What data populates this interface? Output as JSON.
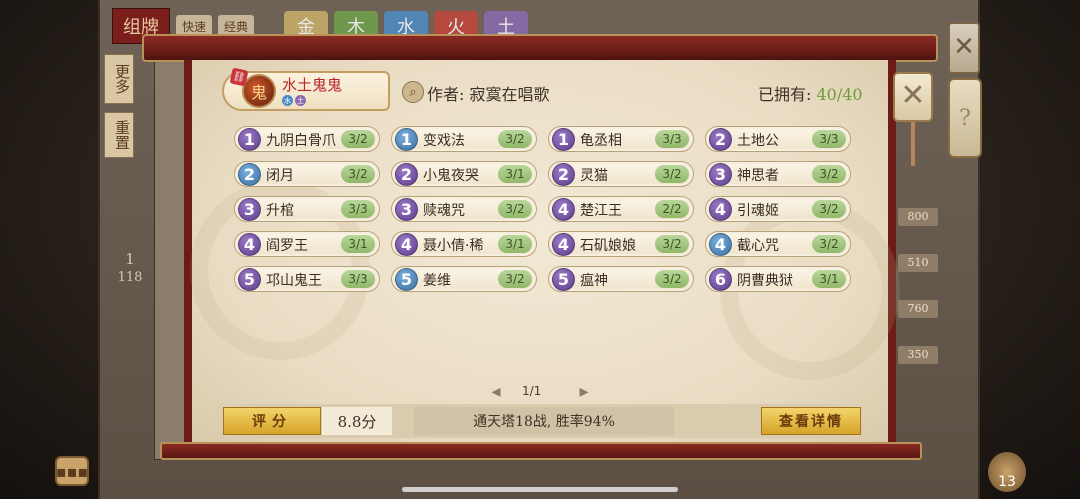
{
  "background": {
    "title": "组牌",
    "pills": [
      "快速",
      "经典"
    ],
    "elements": [
      {
        "label": "金",
        "color": "#c9b06a"
      },
      {
        "label": "木",
        "color": "#6fa24a"
      },
      {
        "label": "水",
        "color": "#4c8cc4"
      },
      {
        "label": "火",
        "color": "#c2453a"
      },
      {
        "label": "土",
        "color": "#8a6bb0"
      }
    ],
    "side_buttons": [
      "更多",
      "重置"
    ],
    "left_count": "1",
    "left_count_total": "118",
    "right_numbers": [
      "800",
      "510",
      "760",
      "350"
    ],
    "bag_count": "13"
  },
  "deck": {
    "name": "水土鬼鬼",
    "author_label": "作者:",
    "author": "寂寞在唱歌",
    "owned_label": "已拥有:",
    "owned_value": "40/40"
  },
  "cards": [
    {
      "cost": "1",
      "color": "purple",
      "name": "九阴白骨爪",
      "qty": "3/2"
    },
    {
      "cost": "1",
      "color": "blue",
      "name": "变戏法",
      "qty": "3/2"
    },
    {
      "cost": "1",
      "color": "purple",
      "name": "龟丞相",
      "qty": "3/3"
    },
    {
      "cost": "2",
      "color": "purple",
      "name": "土地公",
      "qty": "3/3"
    },
    {
      "cost": "2",
      "color": "blue",
      "name": "闭月",
      "qty": "3/2"
    },
    {
      "cost": "2",
      "color": "purple",
      "name": "小鬼夜哭",
      "qty": "3/1"
    },
    {
      "cost": "2",
      "color": "purple",
      "name": "灵猫",
      "qty": "3/2"
    },
    {
      "cost": "3",
      "color": "purple",
      "name": "神思者",
      "qty": "3/2"
    },
    {
      "cost": "3",
      "color": "purple",
      "name": "升棺",
      "qty": "3/3"
    },
    {
      "cost": "3",
      "color": "purple",
      "name": "赎魂咒",
      "qty": "3/2"
    },
    {
      "cost": "4",
      "color": "purple",
      "name": "楚江王",
      "qty": "2/2"
    },
    {
      "cost": "4",
      "color": "purple",
      "name": "引魂姬",
      "qty": "3/2"
    },
    {
      "cost": "4",
      "color": "purple",
      "name": "阎罗王",
      "qty": "3/1"
    },
    {
      "cost": "4",
      "color": "purple",
      "name": "聂小倩·稀",
      "qty": "3/1"
    },
    {
      "cost": "4",
      "color": "purple",
      "name": "石矶娘娘",
      "qty": "3/2"
    },
    {
      "cost": "4",
      "color": "blue",
      "name": "截心咒",
      "qty": "3/2"
    },
    {
      "cost": "5",
      "color": "purple",
      "name": "邛山鬼王",
      "qty": "3/3"
    },
    {
      "cost": "5",
      "color": "blue",
      "name": "姜维",
      "qty": "3/2"
    },
    {
      "cost": "5",
      "color": "purple",
      "name": "瘟神",
      "qty": "3/2"
    },
    {
      "cost": "6",
      "color": "purple",
      "name": "阴曹典狱",
      "qty": "3/1"
    }
  ],
  "pagination": {
    "text": "1/1"
  },
  "footer": {
    "score_label": "评分",
    "score_value": "8.8分",
    "record": "通天塔18战, 胜率94%",
    "detail_button": "查看详情"
  },
  "icons": {
    "close": "close-icon",
    "search": "magnifier-icon",
    "chat": "chat-icon"
  }
}
